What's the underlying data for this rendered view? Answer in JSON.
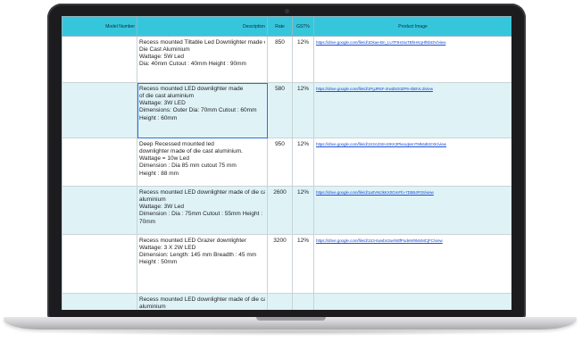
{
  "table": {
    "headers": {
      "model": "Model Number",
      "description": "Description",
      "rate": "Rate",
      "gst": "GST%",
      "image": "Product Image"
    },
    "rows": [
      {
        "model": "",
        "desc": [
          "Recess mounted Tiltable Led Downlighter made of",
          "Die Cast Aluminium",
          "Wattage: 5W Led",
          "Dia: 40mm Cutout : 40mm Height : 90mm"
        ],
        "rate": "850",
        "gst": "12%",
        "link": "https://drive.google.com/file/d/1Dkae-Bn_LU7FtH4sxTBhHKqHfNbt3V/view"
      },
      {
        "model": "",
        "desc": [
          "Recess mounted LED downlighter made",
          "of die cast aluminium",
          "Wattage: 3W LED",
          "Dimensions: Outer Dia: 70mm Cutout : 60mm",
          "Height : 60mm"
        ],
        "rate": "580",
        "gst": "12%",
        "link": "https://drive.google.com/file/d/1PgJR5F-2rwd5G0ZP6-4bBVL3/view"
      },
      {
        "model": "",
        "desc": [
          "Deep Recessed mounted led",
          "downlighter made of die cast aluminium.",
          "Wattage = 10w Led",
          "Dimension : Dia 85 mm cutout 75 mm",
          "Height : 88 mm"
        ],
        "rate": "950",
        "gst": "12%",
        "link": "https://drive.google.com/file/d/1S3A2S8-n0KK3PkexqlemTMk6dKEXK/view"
      },
      {
        "model": "",
        "desc": [
          "Recess mounted LED downlighter made of die cast",
          "aluminium",
          "Wattage: 3W Led",
          "Dimension : Dia : 75mm Cutout : 55mm Height :",
          "70mm"
        ],
        "rate": "2600",
        "gst": "12%",
        "link": "https://drive.google.com/file/d/1a0VWJkKX0GmFfo-7D5B4F0S/view"
      },
      {
        "model": "",
        "desc": [
          "Recess mounted LED Grazer downlighter",
          "Wattage: 3 X 2W LED",
          "Dimension: Length: 145 mm Breadth : 45 mm",
          "Height : 50mm"
        ],
        "rate": "3200",
        "gst": "12%",
        "link": "https://drive.google.com/file/d/1S3-6uwbn3ueh8tfPodeW9MoMCjFC/view"
      },
      {
        "model": "",
        "desc": [
          "Recess mounted LED downlighter made of die cast",
          "aluminium"
        ],
        "rate": "",
        "gst": "",
        "link": ""
      }
    ]
  }
}
